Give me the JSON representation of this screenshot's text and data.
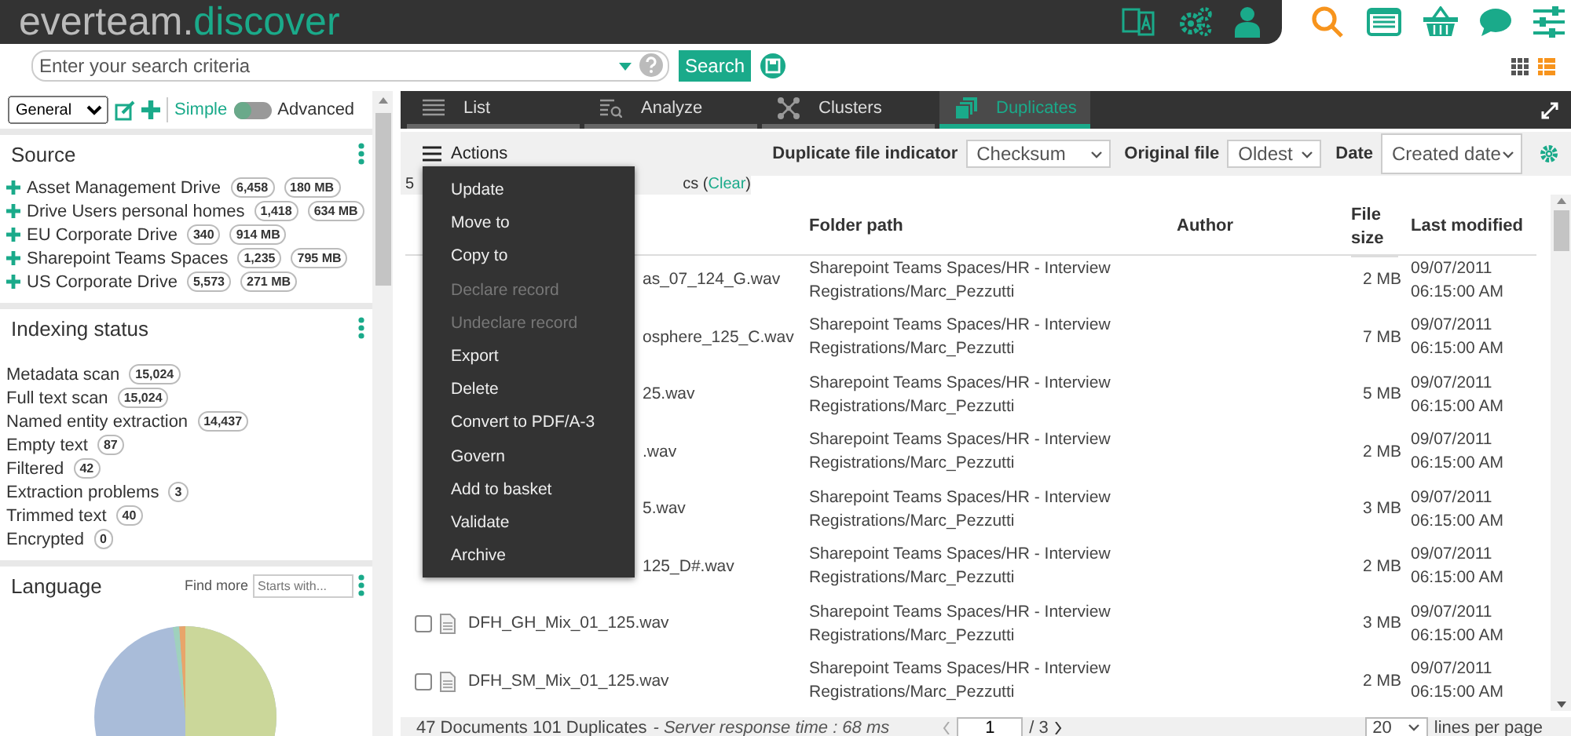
{
  "header": {
    "logo": {
      "brand": "everteam.",
      "product": "discover"
    }
  },
  "search": {
    "placeholder": "Enter your search criteria",
    "button": "Search"
  },
  "left": {
    "profile": "General",
    "mode": {
      "simple": "Simple",
      "advanced": "Advanced",
      "advanced_on": false
    },
    "source": {
      "title": "Source",
      "items": [
        {
          "name": "Asset Management Drive",
          "count": "6,458",
          "size": "180 MB"
        },
        {
          "name": "Drive Users personal homes",
          "count": "1,418",
          "size": "634 MB"
        },
        {
          "name": "EU Corporate Drive",
          "count": "340",
          "size": "914 MB"
        },
        {
          "name": "Sharepoint Teams Spaces",
          "count": "1,235",
          "size": "795 MB"
        },
        {
          "name": "US Corporate Drive",
          "count": "5,573",
          "size": "271 MB"
        }
      ]
    },
    "indexing": {
      "title": "Indexing status",
      "items": [
        {
          "name": "Metadata scan",
          "count": "15,024"
        },
        {
          "name": "Full text scan",
          "count": "15,024"
        },
        {
          "name": "Named entity extraction",
          "count": "14,437"
        },
        {
          "name": "Empty text",
          "count": "87"
        },
        {
          "name": "Filtered",
          "count": "42"
        },
        {
          "name": "Extraction problems",
          "count": "3"
        },
        {
          "name": "Trimmed text",
          "count": "40"
        },
        {
          "name": "Encrypted",
          "count": "0"
        }
      ]
    },
    "language": {
      "title": "Language",
      "find_more": "Find more",
      "placeholder": "Starts with..."
    }
  },
  "tabs": [
    {
      "label": "List",
      "selected": false
    },
    {
      "label": "Analyze",
      "selected": false
    },
    {
      "label": "Clusters",
      "selected": false
    },
    {
      "label": "Duplicates",
      "selected": true
    }
  ],
  "toolbar": {
    "actions": "Actions",
    "dup_label": "Duplicate file indicator",
    "dup_value": "Checksum",
    "orig_label": "Original file",
    "orig_value": "Oldest",
    "date_label": "Date",
    "date_value": "Created date"
  },
  "summary": {
    "lead": "5",
    "tail": "cs (",
    "link": "Clear",
    "close": ")"
  },
  "table": {
    "columns": [
      "Folder path",
      "Author",
      "File size",
      "Last modified"
    ],
    "rows": [
      {
        "kind": "covered",
        "name": "as_07_124_G.wav",
        "folder": "Sharepoint Teams Spaces/HR - Interview Registrations/Marc_Pezzutti",
        "size": "2 MB",
        "modified": "09/07/2011 06:15:00 AM"
      },
      {
        "kind": "covered",
        "name": "osphere_125_C.wav",
        "folder": "Sharepoint Teams Spaces/HR - Interview Registrations/Marc_Pezzutti",
        "size": "7 MB",
        "modified": "09/07/2011 06:15:00 AM"
      },
      {
        "kind": "covered",
        "name": "25.wav",
        "folder": "Sharepoint Teams Spaces/HR - Interview Registrations/Marc_Pezzutti",
        "size": "5 MB",
        "modified": "09/07/2011 06:15:00 AM"
      },
      {
        "kind": "covered",
        "name": ".wav",
        "folder": "Sharepoint Teams Spaces/HR - Interview Registrations/Marc_Pezzutti",
        "size": "2 MB",
        "modified": "09/07/2011 06:15:00 AM"
      },
      {
        "kind": "covered",
        "name": "5.wav",
        "folder": "Sharepoint Teams Spaces/HR - Interview Registrations/Marc_Pezzutti",
        "size": "3 MB",
        "modified": "09/07/2011 06:15:00 AM"
      },
      {
        "kind": "covered",
        "name": "125_D#.wav",
        "folder": "Sharepoint Teams Spaces/HR - Interview Registrations/Marc_Pezzutti",
        "size": "2 MB",
        "modified": "09/07/2011 06:15:00 AM"
      },
      {
        "kind": "full",
        "checked": false,
        "name": "DFH_GH_Mix_01_125.wav",
        "folder": "Sharepoint Teams Spaces/HR - Interview Registrations/Marc_Pezzutti",
        "size": "3 MB",
        "modified": "09/07/2011 06:15:00 AM"
      },
      {
        "kind": "full",
        "checked": false,
        "name": "DFH_SM_Mix_01_125.wav",
        "folder": "Sharepoint Teams Spaces/HR - Interview Registrations/Marc_Pezzutti",
        "size": "2 MB",
        "modified": "09/07/2011 06:15:00 AM"
      }
    ]
  },
  "menu": [
    {
      "label": "Update",
      "disabled": false
    },
    {
      "label": "Move to",
      "disabled": false
    },
    {
      "label": "Copy to",
      "disabled": false
    },
    {
      "label": "Declare record",
      "disabled": true
    },
    {
      "label": "Undeclare record",
      "disabled": true
    },
    {
      "label": "Export",
      "disabled": false
    },
    {
      "label": "Delete",
      "disabled": false
    },
    {
      "label": "Convert to PDF/A-3",
      "disabled": false
    },
    {
      "label": "Govern",
      "disabled": false
    },
    {
      "label": "Add to basket",
      "disabled": false
    },
    {
      "label": "Validate",
      "disabled": false
    },
    {
      "label": "Archive",
      "disabled": false
    }
  ],
  "footer": {
    "documents": "47 Documents 101 Duplicates",
    "response": "- Server response time : 68 ms",
    "page": "1",
    "pages": "/ 3",
    "per_page": "20",
    "per_page_label": "lines per page"
  }
}
